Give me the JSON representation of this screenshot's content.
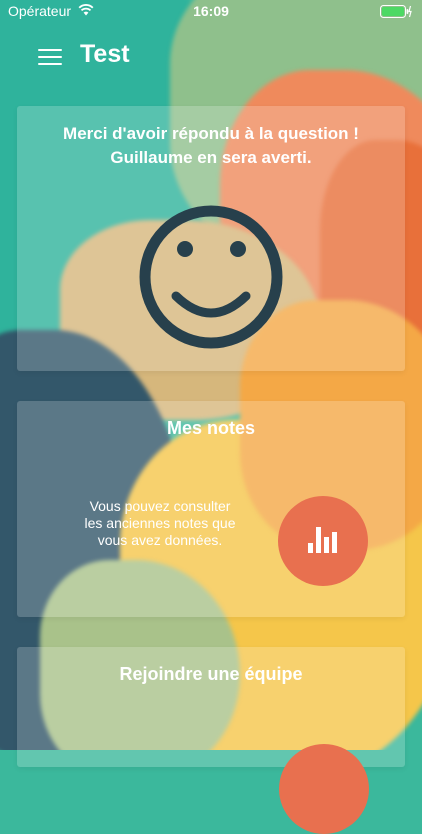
{
  "status_bar": {
    "carrier": "Opérateur",
    "time": "16:09"
  },
  "header": {
    "title": "Test"
  },
  "confirmation": {
    "message_line1": "Merci d'avoir répondu à la question !",
    "message_line2": "Guillaume en sera averti."
  },
  "notes_card": {
    "title": "Mes notes",
    "text_line1": "Vous pouvez consulter",
    "text_line2": "les anciennes notes que",
    "text_line3": "vous avez données."
  },
  "team_card": {
    "title": "Rejoindre une équipe"
  },
  "colors": {
    "accent": "#e8704f",
    "smiley": "#27404c"
  },
  "icons": [
    "wifi-icon",
    "battery-icon",
    "menu-icon",
    "smiley-icon",
    "bar-chart-icon"
  ]
}
